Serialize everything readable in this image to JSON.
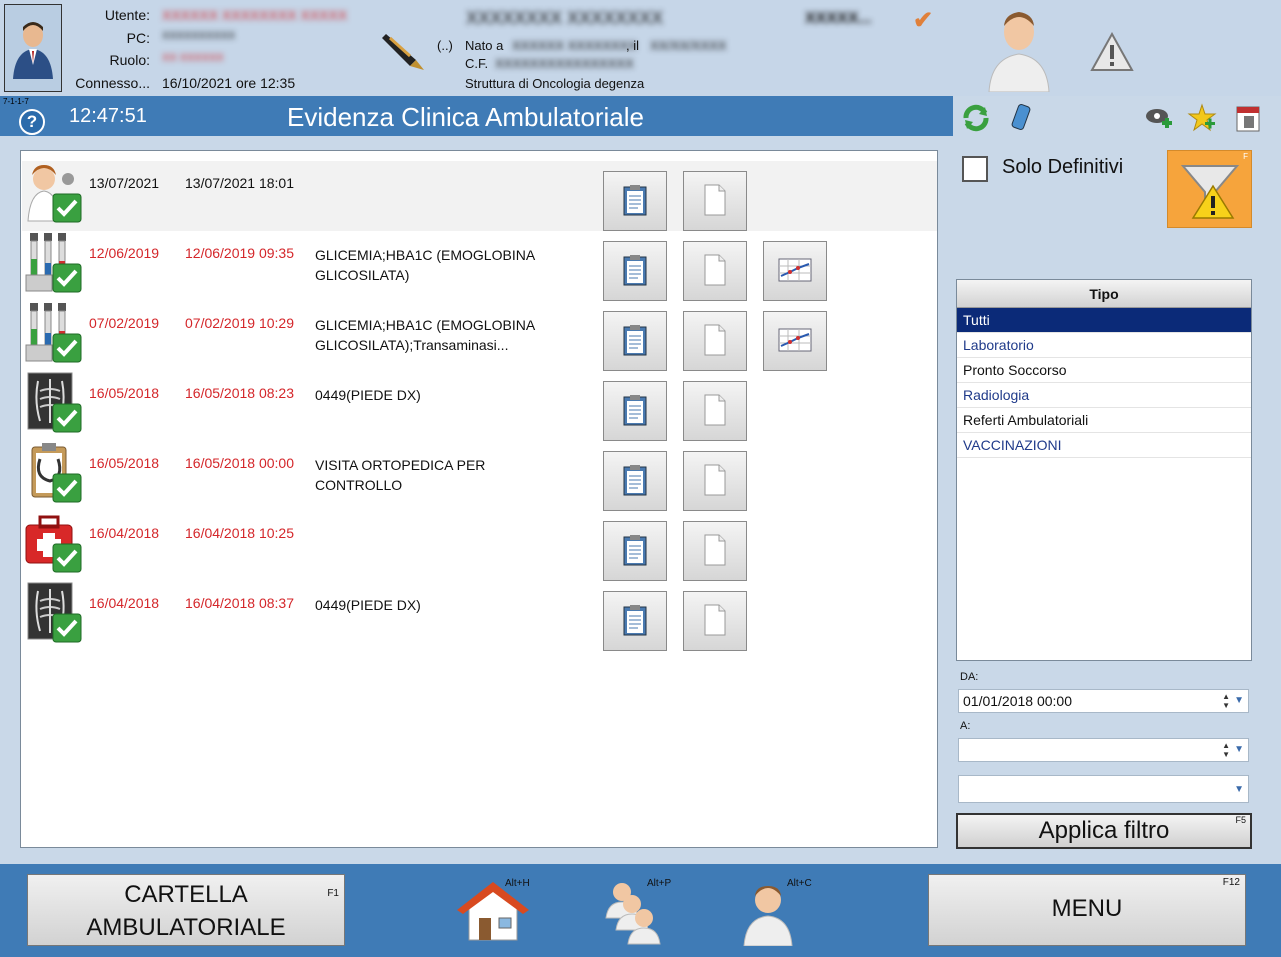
{
  "header": {
    "user_label": "Utente:",
    "user_value": "XXXXXX XXXXXXXX XXXXX",
    "pc_label": "PC:",
    "pc_value": "XXXXXXXXXX",
    "role_label": "Ruolo:",
    "role_value": "XX XXXXXX",
    "connected_label": "Connesso...",
    "connected_value": "16/10/2021 ore 12:35",
    "patient_name": "XXXXXXXX XXXXXXXX",
    "patient_id_short": "XXXXX...",
    "marker": "(..)",
    "born_label": "Nato a",
    "born_place": "XXXXXX XXXXXXXX",
    "born_on_label": ", il",
    "born_date": "XX/XX/XXXX",
    "cf_label": "C.F.",
    "cf_value": "XXXXXXXXXXXXXXXX",
    "structure": "Struttura di Oncologia degenza"
  },
  "titlebar": {
    "version": "7-1-1-7",
    "help": "?",
    "clock": "12:47:51",
    "title": "Evidenza Clinica Ambulatoriale"
  },
  "rows": [
    {
      "date": "13/07/2021",
      "datetime": "13/07/2021 18:01",
      "desc": "",
      "red": false,
      "icon": "doctor-icon",
      "chart": false
    },
    {
      "date": "12/06/2019",
      "datetime": "12/06/2019 09:35",
      "desc": "GLICEMIA;HBA1C (EMOGLOBINA GLICOSILATA)",
      "red": true,
      "icon": "lab-tubes-icon",
      "chart": true
    },
    {
      "date": "07/02/2019",
      "datetime": "07/02/2019 10:29",
      "desc": "GLICEMIA;HBA1C (EMOGLOBINA GLICOSILATA);Transaminasi...",
      "red": true,
      "icon": "lab-tubes-icon",
      "chart": true
    },
    {
      "date": "16/05/2018",
      "datetime": "16/05/2018 08:23",
      "desc": "0449(PIEDE DX)",
      "red": true,
      "icon": "xray-icon",
      "chart": false
    },
    {
      "date": "16/05/2018",
      "datetime": "16/05/2018 00:00",
      "desc": "VISITA ORTOPEDICA PER CONTROLLO",
      "red": true,
      "icon": "clipboard-stethoscope-icon",
      "chart": false
    },
    {
      "date": "16/04/2018",
      "datetime": "16/04/2018 10:25",
      "desc": "",
      "red": true,
      "icon": "first-aid-icon",
      "chart": false
    },
    {
      "date": "16/04/2018",
      "datetime": "16/04/2018 08:37",
      "desc": "0449(PIEDE DX)",
      "red": true,
      "icon": "xray-icon",
      "chart": false
    }
  ],
  "filters": {
    "solo_definitivi": "Solo Definitivi",
    "filter_key": "F",
    "tipo_header": "Tipo",
    "tipo_items": [
      {
        "label": "Tutti",
        "active": true,
        "blue": false
      },
      {
        "label": "Laboratorio",
        "active": false,
        "blue": true
      },
      {
        "label": "Pronto Soccorso",
        "active": false,
        "blue": false
      },
      {
        "label": "Radiologia",
        "active": false,
        "blue": true
      },
      {
        "label": "Referti Ambulatoriali",
        "active": false,
        "blue": false
      },
      {
        "label": "VACCINAZIONI",
        "active": false,
        "blue": true
      }
    ],
    "da_label": "DA:",
    "da_value": "01/01/2018 00:00",
    "a_label": "A:",
    "a_value": "",
    "extra_value": "",
    "apply_label": "Applica filtro",
    "apply_key": "F5"
  },
  "bottom": {
    "cartella_line1": "CARTELLA",
    "cartella_line2": "AMBULATORIALE",
    "cartella_key": "F1",
    "home_key": "Alt+H",
    "patients_key": "Alt+P",
    "patient_key": "Alt+C",
    "menu_label": "MENU",
    "menu_key": "F12"
  },
  "colors": {
    "accent": "#3f7bb6",
    "red": "#d4262a",
    "selected": "#0b2a78",
    "orange": "#f6a43c"
  }
}
